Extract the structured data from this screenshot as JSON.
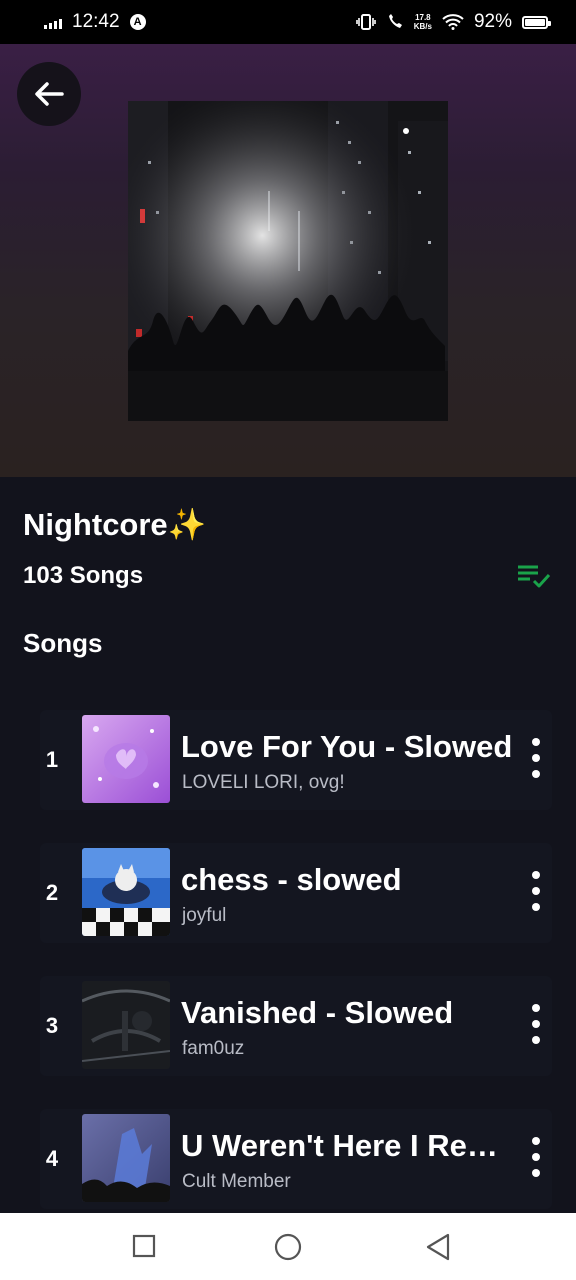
{
  "status_bar": {
    "time": "12:42",
    "speed_top": "17.8",
    "speed_bottom": "KB/s",
    "battery": "92%",
    "battery_level": 0.92
  },
  "header": {
    "back_icon": "arrow-left-icon"
  },
  "playlist": {
    "title": "Nightcore✨",
    "count": "103 Songs",
    "queue_icon": "playlist-check-icon",
    "accent_color": "#1aa34a"
  },
  "section": {
    "title": "Songs"
  },
  "songs": [
    {
      "num": "1",
      "title": "Love For You - Slowed",
      "artist": "LOVELI LORI, ovg!"
    },
    {
      "num": "2",
      "title": "chess - slowed",
      "artist": "joyful"
    },
    {
      "num": "3",
      "title": "Vanished - Slowed",
      "artist": "fam0uz"
    },
    {
      "num": "4",
      "title": "U Weren't Here I Really Miss You",
      "artist": "Cult Member"
    }
  ],
  "nav": {
    "recents_icon": "square-icon",
    "home_icon": "circle-icon",
    "back_icon": "triangle-back-icon"
  }
}
